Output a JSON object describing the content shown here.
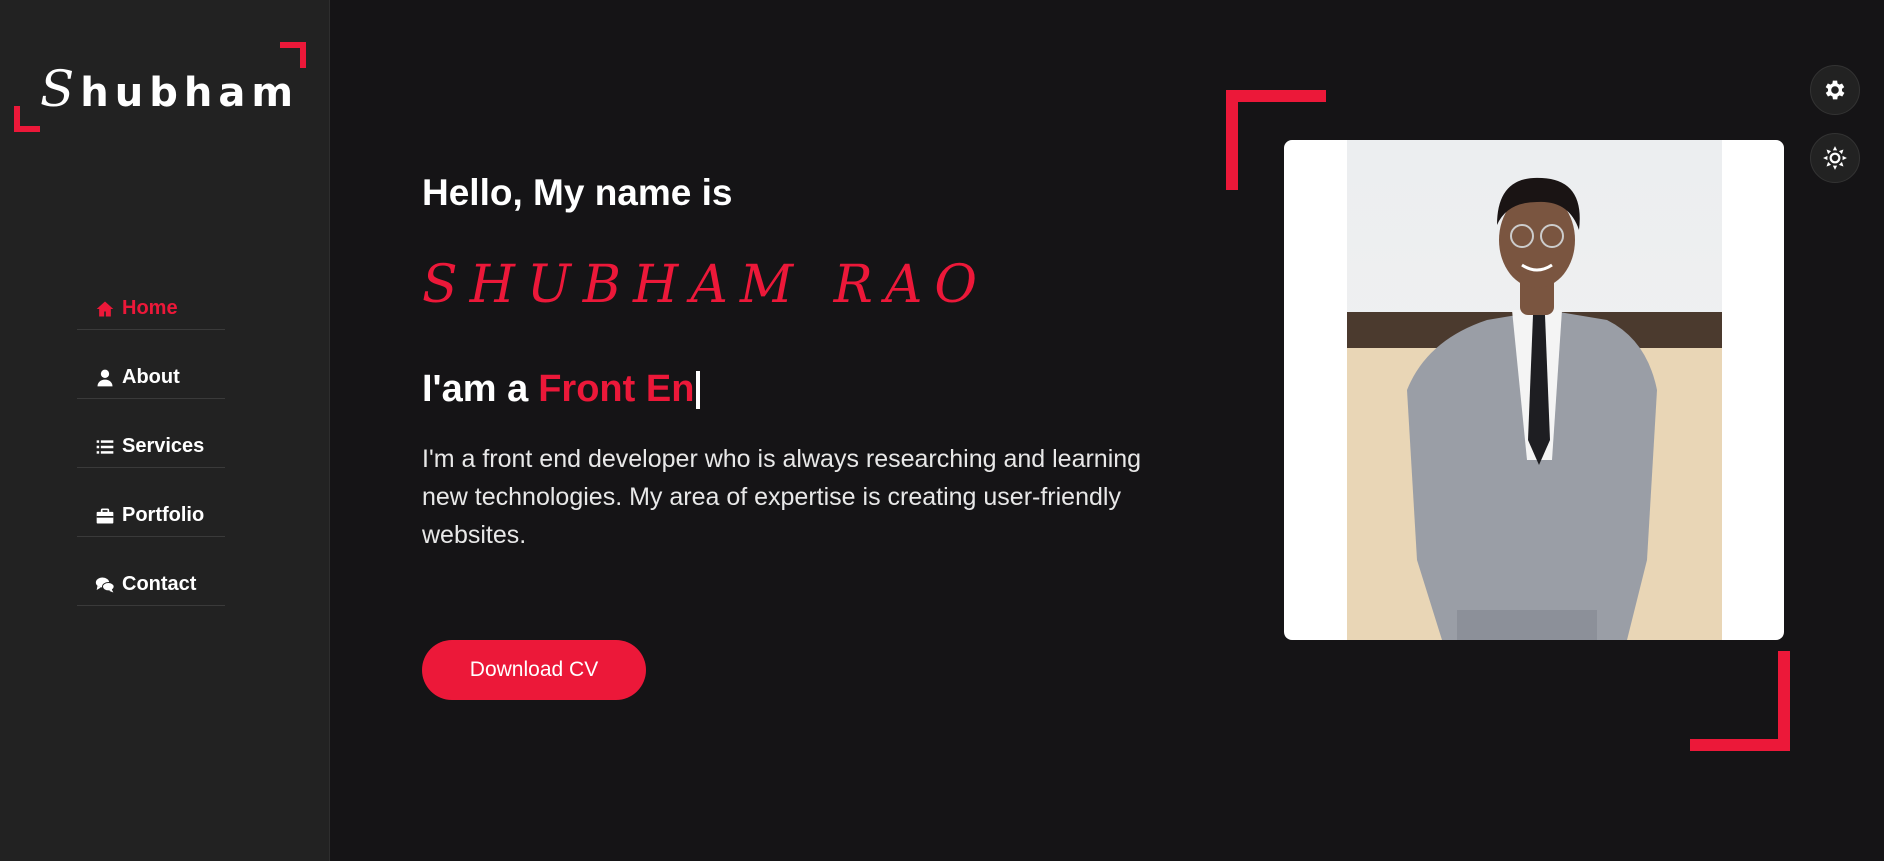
{
  "logo": {
    "first_letter": "S",
    "rest": "hubham"
  },
  "nav": {
    "items": [
      {
        "label": "Home",
        "icon": "home-icon"
      },
      {
        "label": "About",
        "icon": "user-icon"
      },
      {
        "label": "Services",
        "icon": "list-icon"
      },
      {
        "label": "Portfolio",
        "icon": "briefcase-icon"
      },
      {
        "label": "Contact",
        "icon": "comments-icon"
      }
    ],
    "active": "Home"
  },
  "hero": {
    "greeting": "Hello, My name is",
    "name": "SHUBHAM RAO",
    "iam_prefix": "I'am a",
    "role_typed": "Front En",
    "description": "I'm a front end developer who is always researching and learning new technologies. My area of expertise is creating user-friendly websites.",
    "download_label": "Download CV"
  },
  "settings": {
    "style_switcher_icon": "gear-icon",
    "day_night_icon": "sun-icon"
  },
  "colors": {
    "accent": "#ec1839",
    "background": "#151416",
    "sidebar": "#222222"
  }
}
